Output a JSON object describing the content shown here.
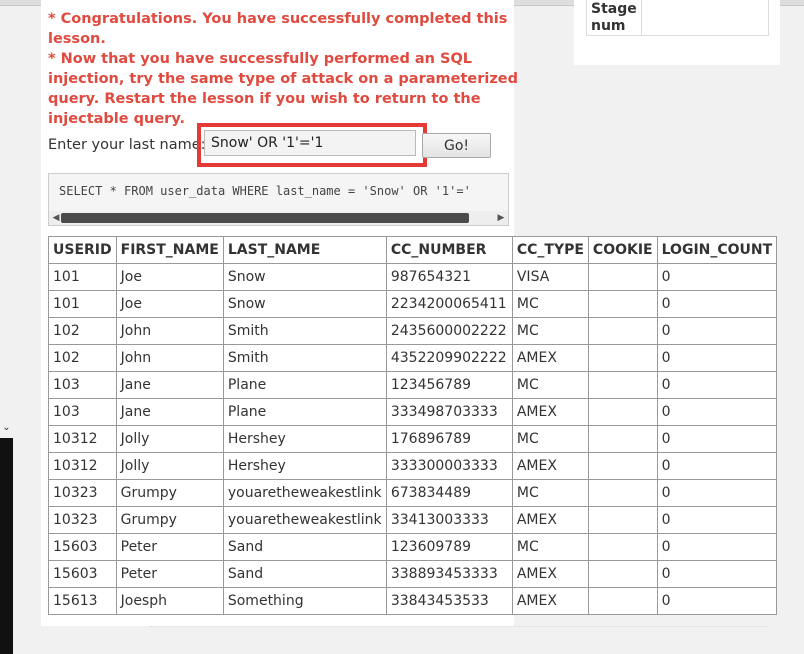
{
  "stage": {
    "label": "Stage num",
    "value": ""
  },
  "messages": [
    "* Congratulations. You have successfully completed this lesson.",
    "* Now that you have successfully performed an SQL injection, try the same type of attack on a parameterized query. Restart the lesson if you wish to return to the injectable query."
  ],
  "form": {
    "label": "Enter your last name:",
    "input_value": "Snow' OR '1'='1",
    "button_label": "Go!"
  },
  "query": "SELECT * FROM user_data WHERE last_name = 'Snow' OR '1'='",
  "table": {
    "headers": [
      "USERID",
      "FIRST_NAME",
      "LAST_NAME",
      "CC_NUMBER",
      "CC_TYPE",
      "COOKIE",
      "LOGIN_COUNT"
    ],
    "rows": [
      [
        "101",
        "Joe",
        "Snow",
        "987654321",
        "VISA",
        "",
        "0"
      ],
      [
        "101",
        "Joe",
        "Snow",
        "2234200065411",
        "MC",
        "",
        "0"
      ],
      [
        "102",
        "John",
        "Smith",
        "2435600002222",
        "MC",
        "",
        "0"
      ],
      [
        "102",
        "John",
        "Smith",
        "4352209902222",
        "AMEX",
        "",
        "0"
      ],
      [
        "103",
        "Jane",
        "Plane",
        "123456789",
        "MC",
        "",
        "0"
      ],
      [
        "103",
        "Jane",
        "Plane",
        "333498703333",
        "AMEX",
        "",
        "0"
      ],
      [
        "10312",
        "Jolly",
        "Hershey",
        "176896789",
        "MC",
        "",
        "0"
      ],
      [
        "10312",
        "Jolly",
        "Hershey",
        "333300003333",
        "AMEX",
        "",
        "0"
      ],
      [
        "10323",
        "Grumpy",
        "youaretheweakestlink",
        "673834489",
        "MC",
        "",
        "0"
      ],
      [
        "10323",
        "Grumpy",
        "youaretheweakestlink",
        "33413003333",
        "AMEX",
        "",
        "0"
      ],
      [
        "15603",
        "Peter",
        "Sand",
        "123609789",
        "MC",
        "",
        "0"
      ],
      [
        "15603",
        "Peter",
        "Sand",
        "338893453333",
        "AMEX",
        "",
        "0"
      ],
      [
        "15613",
        "Joesph",
        "Something",
        "33843453533",
        "AMEX",
        "",
        "0"
      ]
    ]
  },
  "icons": {
    "scroll_left": "triangle-left-icon",
    "scroll_right": "triangle-right-icon",
    "side_chevron": "chevron-down-icon"
  }
}
